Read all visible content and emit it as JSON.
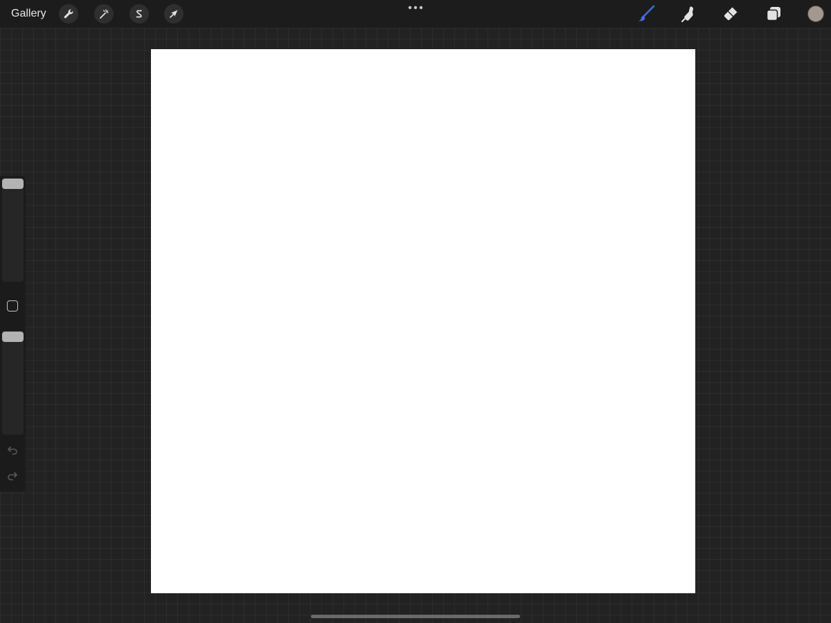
{
  "toolbar": {
    "gallery_label": "Gallery",
    "left_tools": [
      {
        "name": "actions",
        "icon": "wrench-icon"
      },
      {
        "name": "adjustments",
        "icon": "magic-wand-icon"
      },
      {
        "name": "selection",
        "icon": "selection-s-icon"
      },
      {
        "name": "transform",
        "icon": "arrow-cursor-icon"
      }
    ],
    "more_icon": "ellipsis-icon",
    "right_tools": [
      {
        "name": "brush",
        "icon": "brush-icon",
        "active": true,
        "color": "#3b6fe0"
      },
      {
        "name": "smudge",
        "icon": "smudge-icon",
        "active": false,
        "color": "#e2e2e2"
      },
      {
        "name": "eraser",
        "icon": "eraser-icon",
        "active": false,
        "color": "#e2e2e2"
      },
      {
        "name": "layers",
        "icon": "layers-icon",
        "active": false,
        "color": "#e2e2e2"
      }
    ],
    "current_color": "#a39890"
  },
  "canvas": {
    "background": "#ffffff"
  },
  "sidebar": {
    "brush_size_icon": "slider-thumb",
    "modify_icon": "square-icon",
    "opacity_icon": "slider-thumb",
    "undo_icon": "undo-arrow-icon",
    "redo_icon": "redo-arrow-icon"
  },
  "colors": {
    "workspace": "#222222",
    "toolbar": "#1c1c1c",
    "accent": "#3b6fe0"
  }
}
